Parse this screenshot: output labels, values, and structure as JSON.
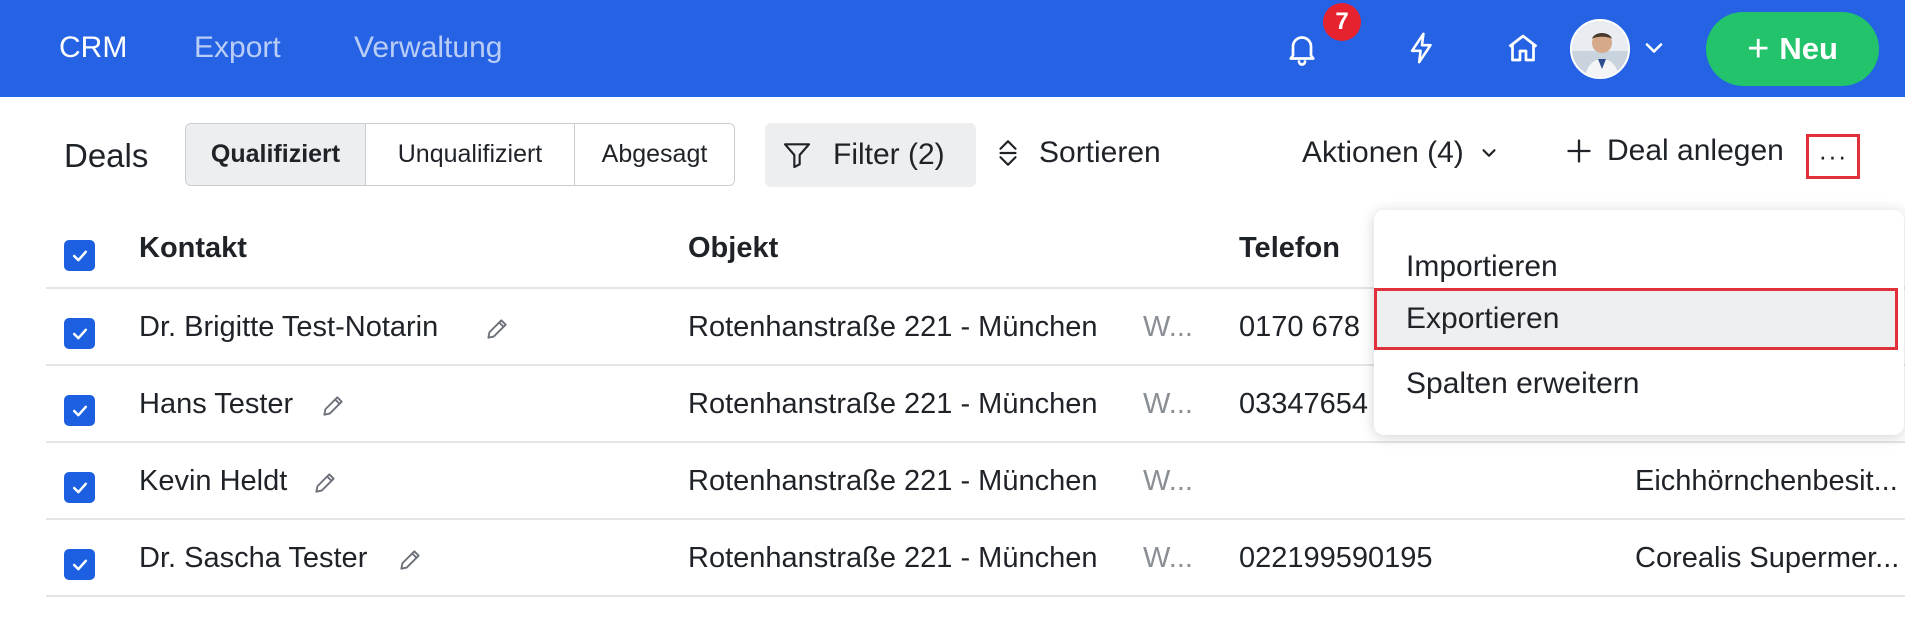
{
  "nav": {
    "links": [
      "CRM",
      "Export",
      "Verwaltung"
    ],
    "notification_count": "7",
    "new_button_label": "Neu",
    "new_button_plus": "+"
  },
  "toolbar": {
    "title": "Deals",
    "segments": [
      "Qualifiziert",
      "Unqualifiziert",
      "Abgesagt"
    ],
    "filter_label": "Filter (2)",
    "sort_label": "Sortieren",
    "actions_label": "Aktionen (4)",
    "add_deal_label": "Deal anlegen",
    "more_label": "···"
  },
  "table": {
    "headers": {
      "contact": "Kontakt",
      "object": "Objekt",
      "phone": "Telefon"
    },
    "rows": [
      {
        "contact": "Dr. Brigitte Test-Notarin",
        "object": "Rotenhanstraße 221 - München",
        "object_extra": "W...",
        "phone": "0170 678",
        "company": ""
      },
      {
        "contact": "Hans Tester",
        "object": "Rotenhanstraße 221 - München",
        "object_extra": "W...",
        "phone": "03347654",
        "company": ""
      },
      {
        "contact": "Kevin Heldt",
        "object": "Rotenhanstraße 221 - München",
        "object_extra": "W...",
        "phone": "",
        "company": "Eichhörnchenbesit..."
      },
      {
        "contact": "Dr. Sascha Tester",
        "object": "Rotenhanstraße 221 - München",
        "object_extra": "W...",
        "phone": "022199590195",
        "company": "Corealis Supermer..."
      }
    ]
  },
  "menu": {
    "items": [
      "Importieren",
      "Exportieren",
      "Spalten erweitern"
    ],
    "highlighted": "Exportieren"
  },
  "colors": {
    "brand_blue": "#2563e4",
    "new_green": "#22c36a",
    "badge_red": "#e5222e",
    "highlight_red": "#e0313a",
    "checkbox_blue": "#1c5fe0"
  },
  "icons": [
    "bell-icon",
    "lightning-icon",
    "home-icon",
    "chevron-down-icon",
    "filter-icon",
    "sort-icon",
    "pencil-icon",
    "checkmark-icon"
  ]
}
